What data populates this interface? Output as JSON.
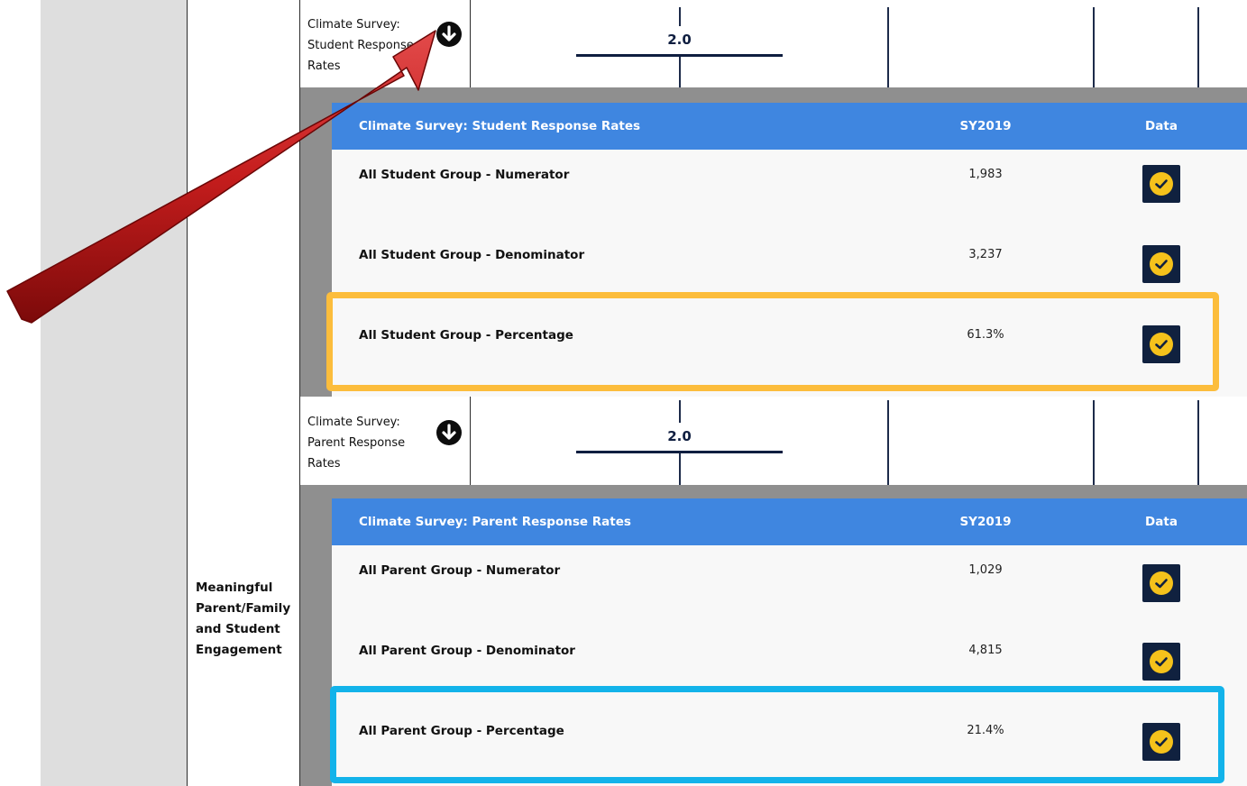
{
  "section": {
    "name": "Meaningful Parent/Family and Student Engagement",
    "lines": [
      "Meaningful",
      "Parent/Family",
      "and Student",
      "Engagement"
    ]
  },
  "metrics": [
    {
      "label_lines": [
        "Climate Survey:",
        "Student Response",
        "Rates"
      ],
      "score": "2.0",
      "table": {
        "title": "Climate Survey: Student Response Rates",
        "year": "SY2019",
        "state_header": "Data State",
        "rows": [
          {
            "label": "All Student Group - Numerator",
            "value": "1,983"
          },
          {
            "label": "All Student Group - Denominator",
            "value": "3,237"
          },
          {
            "label": "All Student Group - Percentage",
            "value": "61.3%"
          }
        ]
      }
    },
    {
      "label_lines": [
        "Climate Survey:",
        "Parent Response",
        "Rates"
      ],
      "score": "2.0",
      "table": {
        "title": "Climate Survey: Parent Response Rates",
        "year": "SY2019",
        "state_header": "Data State",
        "rows": [
          {
            "label": "All Parent Group - Numerator",
            "value": "1,029"
          },
          {
            "label": "All Parent Group - Denominator",
            "value": "4,815"
          },
          {
            "label": "All Parent Group - Percentage",
            "value": "21.4%"
          }
        ]
      }
    }
  ],
  "icons": {
    "expand": "arrow-down-circle-icon",
    "data_state": "check-circle-icon",
    "pointer": "red-arrow-annotation"
  },
  "colors": {
    "header_blue": "#3f86e0",
    "check_yellow": "#f5c21b",
    "highlight_orange": "#fcbd3c",
    "highlight_blue": "#13b3ea",
    "arrow_red": "#c51d1d"
  }
}
